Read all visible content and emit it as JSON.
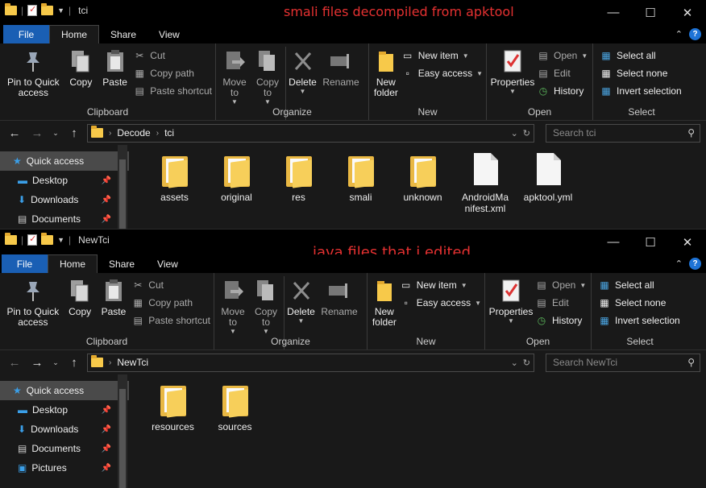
{
  "windows": [
    {
      "title": "tci",
      "overlay_text": "smali files decompiled from apktool",
      "tabs": [
        "File",
        "Home",
        "Share",
        "View"
      ],
      "ribbon": {
        "clipboard": {
          "pin": "Pin to Quick access",
          "copy": "Copy",
          "paste": "Paste",
          "cut": "Cut",
          "copy_path": "Copy path",
          "paste_shortcut": "Paste shortcut",
          "label": "Clipboard"
        },
        "organize": {
          "move_to": "Move to",
          "copy_to": "Copy to",
          "delete": "Delete",
          "rename": "Rename",
          "label": "Organize"
        },
        "new": {
          "new_folder": "New folder",
          "new_item": "New item",
          "easy_access": "Easy access",
          "label": "New"
        },
        "open": {
          "properties": "Properties",
          "open": "Open",
          "edit": "Edit",
          "history": "History",
          "label": "Open"
        },
        "select": {
          "select_all": "Select all",
          "select_none": "Select none",
          "invert": "Invert selection",
          "label": "Select"
        }
      },
      "address": {
        "crumbs": [
          "Decode",
          "tci"
        ],
        "search_placeholder": "Search tci"
      },
      "nav": [
        "Quick access",
        "Desktop",
        "Downloads",
        "Documents"
      ],
      "files": [
        {
          "name": "assets",
          "type": "folder"
        },
        {
          "name": "original",
          "type": "folder"
        },
        {
          "name": "res",
          "type": "folder"
        },
        {
          "name": "smali",
          "type": "folder"
        },
        {
          "name": "unknown",
          "type": "folder"
        },
        {
          "name": "AndroidManifest.xml",
          "type": "file"
        },
        {
          "name": "apktool.yml",
          "type": "file"
        }
      ]
    },
    {
      "title": "NewTci",
      "overlay_text": "java files that i edited",
      "tabs": [
        "File",
        "Home",
        "Share",
        "View"
      ],
      "ribbon": {
        "clipboard": {
          "pin": "Pin to Quick access",
          "copy": "Copy",
          "paste": "Paste",
          "cut": "Cut",
          "copy_path": "Copy path",
          "paste_shortcut": "Paste shortcut",
          "label": "Clipboard"
        },
        "organize": {
          "move_to": "Move to",
          "copy_to": "Copy to",
          "delete": "Delete",
          "rename": "Rename",
          "label": "Organize"
        },
        "new": {
          "new_folder": "New folder",
          "new_item": "New item",
          "easy_access": "Easy access",
          "label": "New"
        },
        "open": {
          "properties": "Properties",
          "open": "Open",
          "edit": "Edit",
          "history": "History",
          "label": "Open"
        },
        "select": {
          "select_all": "Select all",
          "select_none": "Select none",
          "invert": "Invert selection",
          "label": "Select"
        }
      },
      "address": {
        "crumbs": [
          "NewTci"
        ],
        "search_placeholder": "Search NewTci"
      },
      "nav": [
        "Quick access",
        "Desktop",
        "Downloads",
        "Documents",
        "Pictures"
      ],
      "files": [
        {
          "name": "resources",
          "type": "folder"
        },
        {
          "name": "sources",
          "type": "folder"
        }
      ]
    }
  ],
  "colors": {
    "accent": "#1a5fb4",
    "overlay": "#e53131",
    "folder": "#f7c94a"
  }
}
